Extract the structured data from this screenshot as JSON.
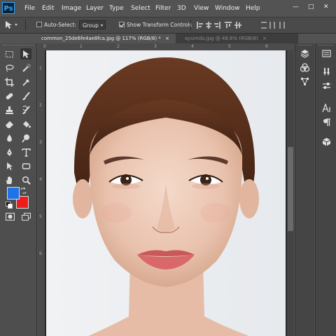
{
  "app": {
    "logo": "Ps"
  },
  "menu": [
    "File",
    "Edit",
    "Image",
    "Layer",
    "Type",
    "Select",
    "Filter",
    "3D",
    "View",
    "Window",
    "Help"
  ],
  "options": {
    "auto_select_label": "Auto-Select:",
    "group_value": "Group",
    "show_transform_label": "Show Transform Controls"
  },
  "tabs": [
    {
      "label": "common_25de6fe4ae8fca.jpg @ 117% (RGB/8) *",
      "close": "×"
    },
    {
      "label": "ayumda.jpg @ 48.8% (RGB/8)",
      "close": "×"
    }
  ],
  "ruler": {
    "top": [
      "0",
      "1",
      "2",
      "3",
      "4",
      "5",
      "6"
    ],
    "left": [
      "1",
      "2",
      "3",
      "4",
      "5",
      "6"
    ]
  },
  "colors": {
    "foreground": "#1e73e8",
    "background": "#ee1c1c",
    "accent": "#31a8ff"
  },
  "tools": [
    "marquee-icon",
    "move-icon",
    "lasso-icon",
    "quick-select-icon",
    "crop-icon",
    "eyedropper-icon",
    "healing-icon",
    "brush-icon",
    "stamp-icon",
    "history-brush-icon",
    "eraser-icon",
    "bucket-icon",
    "blur-icon",
    "dodge-icon",
    "pen-icon",
    "type-icon",
    "path-select-icon",
    "shape-icon",
    "hand-icon",
    "zoom-icon"
  ]
}
